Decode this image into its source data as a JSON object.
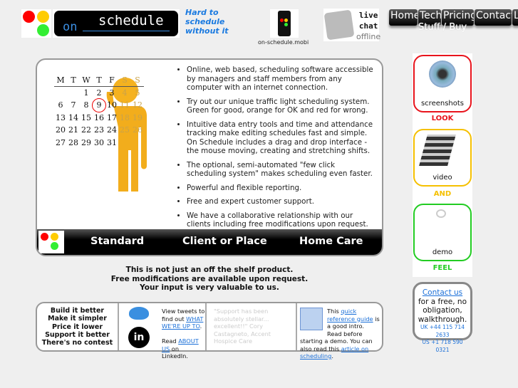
{
  "header": {
    "tagline": [
      "Hard to",
      "schedule",
      "without it"
    ],
    "logo_text_on": "on",
    "logo_text_schedule": "schedule",
    "mobile_label": "on-schedule.mobi",
    "chat": [
      "live",
      "chat",
      "offline"
    ],
    "nav": [
      {
        "label": "Home"
      },
      {
        "label": "Tech"
      },
      {
        "label": "Pricing"
      },
      {
        "label": "Contact"
      },
      {
        "label": "L"
      }
    ],
    "nav_sub": "Stuff / Buy"
  },
  "calendar": {
    "days": [
      "M",
      "T",
      "W",
      "T",
      "F",
      "S",
      "S"
    ],
    "weeks": [
      [
        "",
        "",
        "1",
        "2",
        "3",
        "4",
        "5"
      ],
      [
        "6",
        "7",
        "8",
        "9",
        "10",
        "11",
        "12"
      ],
      [
        "13",
        "14",
        "15",
        "16",
        "17",
        "18",
        "19"
      ],
      [
        "20",
        "21",
        "22",
        "23",
        "24",
        "25",
        "26"
      ],
      [
        "27",
        "28",
        "29",
        "30",
        "31",
        "",
        ""
      ]
    ],
    "highlighted": "9"
  },
  "features": [
    "Online, web based, scheduling software accessible by managers and staff members from any computer with an internet connection.",
    "Try out our unique traffic light scheduling system. Green for good, orange for OK and red for wrong.",
    "Intuitive data entry tools and time and attendance tracking make editing schedules fast and simple. On Schedule includes a drag and drop interface - the mouse moving, creating and stretching shifts.",
    "The optional, semi-automated \"few click scheduling system\" makes scheduling even faster.",
    "Powerful and flexible reporting.",
    "Free and expert customer support.",
    "We have a collaborative relationship with our clients including free modifications upon request."
  ],
  "products": [
    "Standard",
    "Client or Place",
    "Home Care"
  ],
  "message": [
    "This is not just an off the shelf product.",
    "Free modifications are available upon request.",
    "Your input is very valuable to us."
  ],
  "mottos": [
    "Build it better",
    "Make it simpler",
    "Price it lower",
    "Support it better",
    "There's no contest"
  ],
  "social": {
    "tweets_pre": "View tweets to find out ",
    "tweets_link": "WHAT WE'RE UP TO",
    "tweets_post": ".",
    "read": "Read ",
    "about_link": "ABOUT US",
    "about_post": " on LinkedIn."
  },
  "testimonial": "\"Support has been absolutely stellar... excellent!!\" Cory Castagneto, Accent Hospice Care",
  "guide": {
    "pre": "This ",
    "link1": "quick reference guide",
    "mid": " is a good intro. Read before starting a demo. You can also read this ",
    "link2": "article on scheduling",
    "post": "."
  },
  "sidebar": {
    "items": [
      {
        "caption": "screenshots",
        "label": "LOOK",
        "color": "#e8141c"
      },
      {
        "caption": "video",
        "label": "AND",
        "color": "#f5c000"
      },
      {
        "caption": "demo",
        "label": "FEEL",
        "color": "#22cc22"
      }
    ]
  },
  "contact": {
    "link": "Contact us",
    "text": "for a free, no obligation, walkthrough.",
    "uk": "UK +44 115 714 2633",
    "us": "US +1 718 590 0321"
  },
  "colors": {
    "red": "#ff0000",
    "orange": "#ffc000",
    "green": "#33ee33",
    "link": "#1a6fd8"
  }
}
